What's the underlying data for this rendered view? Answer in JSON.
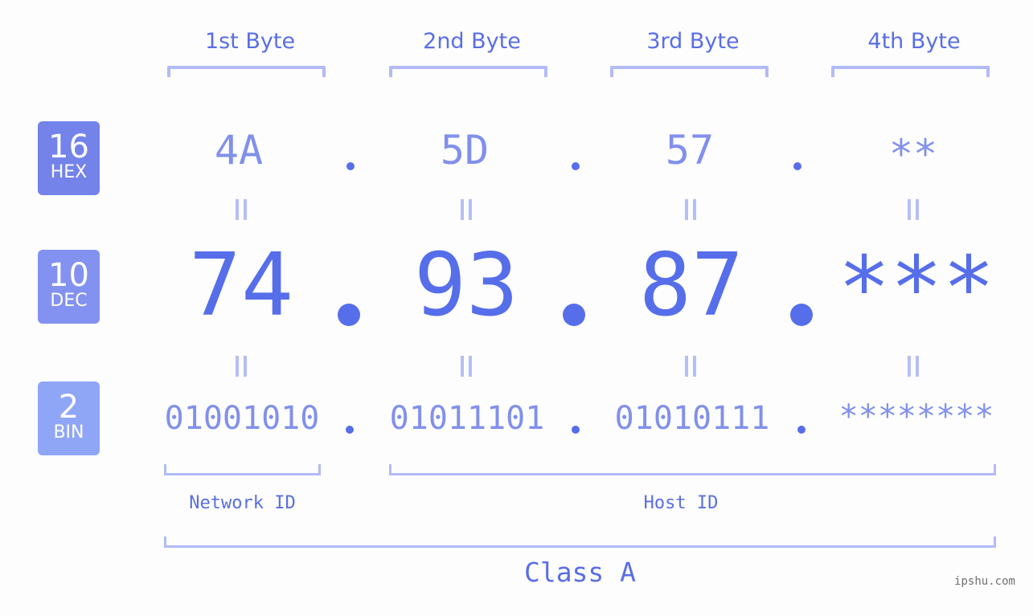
{
  "bytes": [
    {
      "header": "1st Byte",
      "hex": "4A",
      "dec": "74",
      "bin": "01001010"
    },
    {
      "header": "2nd Byte",
      "hex": "5D",
      "dec": "93",
      "bin": "01011101"
    },
    {
      "header": "3rd Byte",
      "hex": "57",
      "dec": "87",
      "bin": "01010111"
    },
    {
      "header": "4th Byte",
      "hex": "**",
      "dec": "***",
      "bin": "********"
    }
  ],
  "badges": {
    "hex": {
      "base": "16",
      "label": "HEX",
      "color": "#7383ea"
    },
    "dec": {
      "base": "10",
      "label": "DEC",
      "color": "#8392f0"
    },
    "bin": {
      "base": "2",
      "label": "BIN",
      "color": "#8fa6f7"
    }
  },
  "segments": {
    "network": "Network ID",
    "host": "Host ID"
  },
  "class_label": "Class A",
  "watermark": "ipshu.com",
  "colors": {
    "accent": "#566ee9",
    "light_accent": "#8190ec",
    "bracket": "#b2bbf7",
    "background": "#fcfdfc"
  }
}
